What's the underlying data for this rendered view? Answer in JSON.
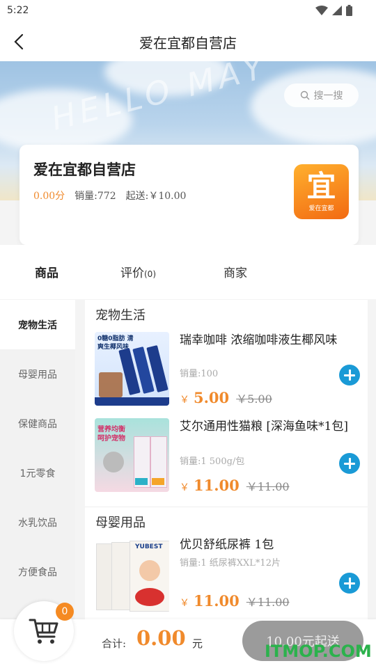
{
  "status_bar": {
    "time": "5:22"
  },
  "nav": {
    "title": "爱在宜都自营店"
  },
  "banner": {
    "deco_text": "HELLO MAY"
  },
  "search": {
    "label": "搜一搜"
  },
  "shop": {
    "name": "爱在宜都自营店",
    "score": "0.00分",
    "sales": "销量:772",
    "min_delivery": "起送:￥10.00",
    "logo_char": "宜",
    "logo_text": "爱在宜都"
  },
  "tabs": [
    {
      "label": "商品"
    },
    {
      "label": "评价",
      "count": "(0)"
    },
    {
      "label": "商家"
    }
  ],
  "categories": [
    "宠物生活",
    "母婴用品",
    "保健商品",
    "1元零食",
    "水乳饮品",
    "方便食品"
  ],
  "sections": [
    {
      "title": "宠物生活",
      "products": [
        {
          "name": "瑞幸咖啡 浓缩咖啡液生椰风味",
          "sales": "销量:100",
          "currency": "￥",
          "price": "5.00",
          "old_price": "￥5.00",
          "img_caption": "0糖0脂肪 清爽生椰风味"
        },
        {
          "name": "艾尔通用性猫粮 [深海鱼味*1包]",
          "sales": "销量:1 500g/包",
          "currency": "￥",
          "price": "11.00",
          "old_price": "￥11.00",
          "img_caption": "营养均衡 呵护宠物"
        }
      ]
    },
    {
      "title": "母婴用品",
      "products": [
        {
          "name": "优贝舒纸尿裤 1包",
          "sales": "销量:1 纸尿裤XXL*12片",
          "currency": "￥",
          "price": "11.00",
          "old_price": "￥11.00",
          "img_caption": "YUBEST"
        }
      ]
    }
  ],
  "cart": {
    "count": "0",
    "total_label": "合计:",
    "total_value": "0.00",
    "total_unit": "元",
    "min_button": "10.00元起送"
  },
  "watermark": "ITMOP.COM",
  "colors": {
    "accent": "#f08a2c",
    "add_button": "#1a9ad6",
    "badge": "#f58a22"
  }
}
